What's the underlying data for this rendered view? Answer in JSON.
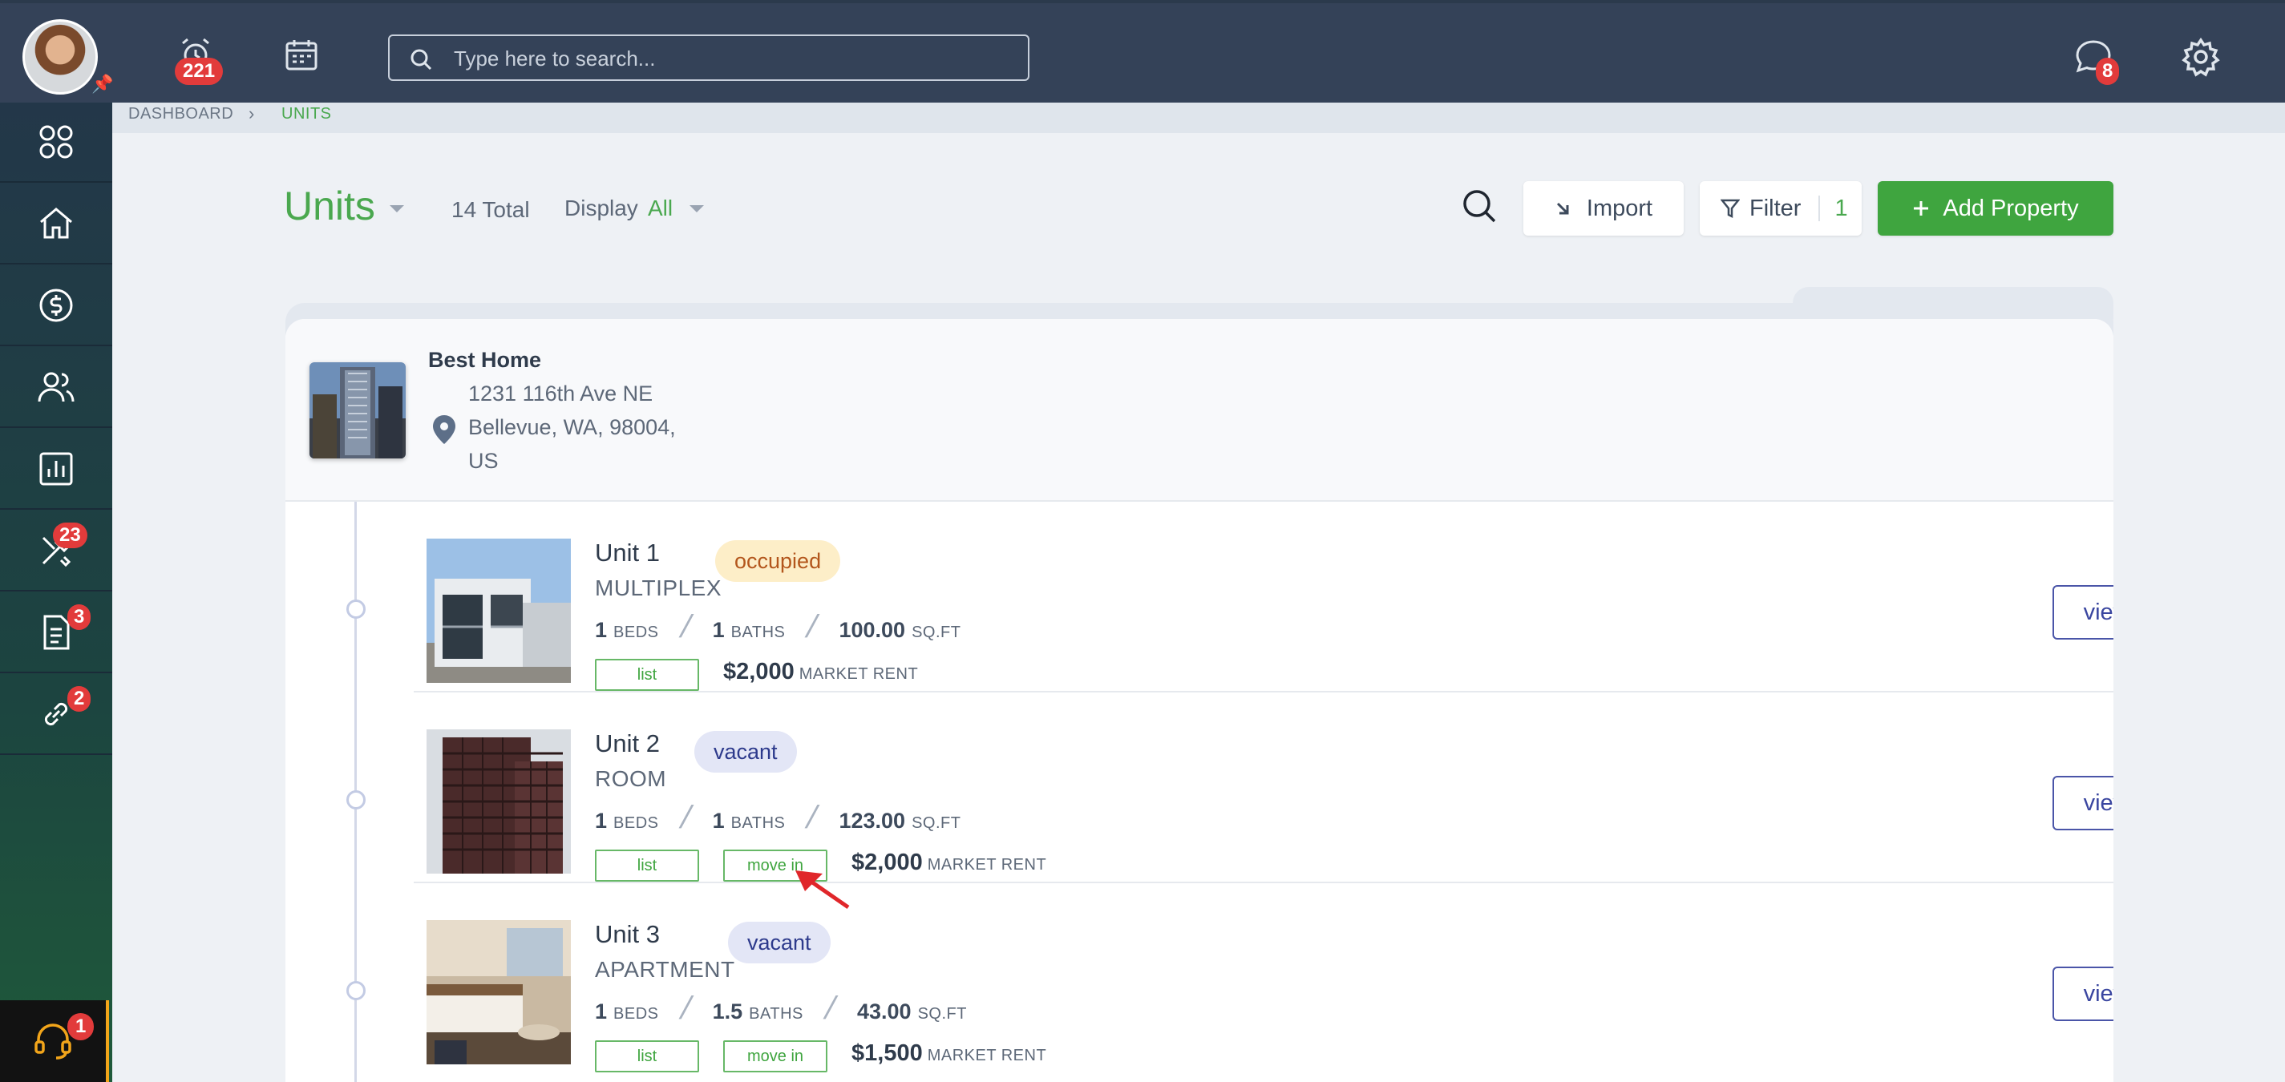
{
  "topbar": {
    "alarm_badge": "221",
    "search_placeholder": "Type here to search...",
    "messages_badge": "8"
  },
  "sidebar": {
    "items": [
      {
        "icon": "apps-grid-icon",
        "badge": ""
      },
      {
        "icon": "home-icon",
        "badge": ""
      },
      {
        "icon": "dollar-icon",
        "badge": ""
      },
      {
        "icon": "users-icon",
        "badge": ""
      },
      {
        "icon": "chart-icon",
        "badge": ""
      },
      {
        "icon": "tools-icon",
        "badge": "23"
      },
      {
        "icon": "document-icon",
        "badge": "3"
      },
      {
        "icon": "link-icon",
        "badge": "2"
      }
    ],
    "support_badge": "1"
  },
  "breadcrumb": {
    "root": "DASHBOARD",
    "current": "UNITS"
  },
  "header": {
    "title": "Units",
    "total": "14 Total",
    "display_label": "Display",
    "display_value": "All",
    "import_label": "Import",
    "filter_label": "Filter",
    "filter_count": "1",
    "add_label": "Add Property"
  },
  "property": {
    "name": "Best Home",
    "address_line1": "1231 116th Ave NE",
    "address_line2": "Bellevue, WA, 98004,",
    "address_line3": "US"
  },
  "units": [
    {
      "name": "Unit 1",
      "type": "MULTIPLEX",
      "status": "occupied",
      "beds": "1",
      "beds_unit": "BEDS",
      "baths": "1",
      "baths_unit": "BATHS",
      "area": "100.00",
      "area_unit": "SQ.FT",
      "list_label": "list",
      "move_in_label": "",
      "rent": "$2,000",
      "rent_unit": "MARKET RENT",
      "view_label": "view unit"
    },
    {
      "name": "Unit 2",
      "type": "ROOM",
      "status": "vacant",
      "beds": "1",
      "beds_unit": "BEDS",
      "baths": "1",
      "baths_unit": "BATHS",
      "area": "123.00",
      "area_unit": "SQ.FT",
      "list_label": "list",
      "move_in_label": "move in",
      "rent": "$2,000",
      "rent_unit": "MARKET RENT",
      "view_label": "view unit"
    },
    {
      "name": "Unit 3",
      "type": "APARTMENT",
      "status": "vacant",
      "beds": "1",
      "beds_unit": "BEDS",
      "baths": "1.5",
      "baths_unit": "BATHS",
      "area": "43.00",
      "area_unit": "SQ.FT",
      "list_label": "list",
      "move_in_label": "move in",
      "rent": "$1,500",
      "rent_unit": "MARKET RENT",
      "view_label": "view unit"
    }
  ],
  "colors": {
    "topbar": "#344258",
    "accent_green": "#3fa53f",
    "badge_red": "#e23b3b",
    "view_button": "#4a55a8"
  }
}
